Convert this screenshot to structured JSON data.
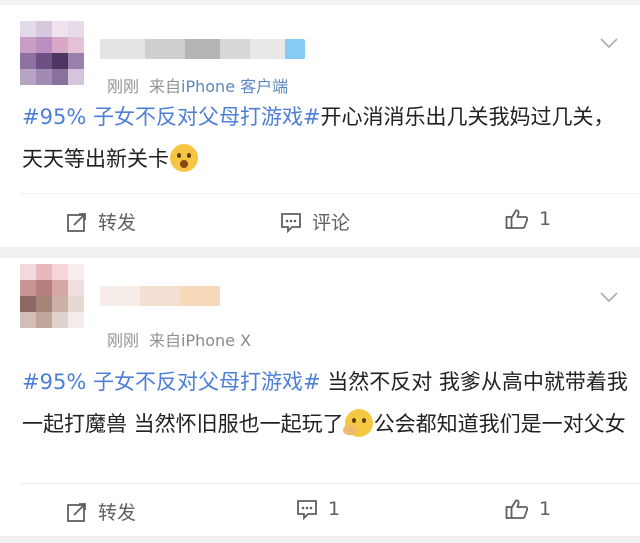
{
  "posts": [
    {
      "time": "刚刚",
      "source_prefix": "来自",
      "device": "iPhone 客户端",
      "hashtag": "#95% 子女不反对父母打游戏#",
      "text_a": "开心消消乐出几关我妈过几关，天天等出新关卡",
      "text_b": "",
      "emoji": "scream-emoji",
      "actions": {
        "repost_label": "转发",
        "comment_label": "评论",
        "like_count": "1"
      }
    },
    {
      "time": "刚刚",
      "source_prefix": "来自",
      "device": "iPhone X",
      "hashtag": "#95% 子女不反对父母打游戏#",
      "text_a": " 当然不反对 我爹从高中就带着我一起打魔兽 当然怀旧服也一起玩了",
      "text_b": "公会都知道我们是一对父女",
      "emoji": "thinking-emoji",
      "actions": {
        "repost_label": "转发",
        "comment_count": "1",
        "like_count": "1"
      }
    }
  ],
  "colors": {
    "hashtag": "#4d7fd6",
    "device_link": "#5b88bd",
    "meta": "#939393",
    "action": "#606060",
    "background": "#f1f1f1"
  },
  "icons": {
    "repost": "repost-icon",
    "comment": "comment-icon",
    "like": "thumbs-up-icon",
    "expand": "chevron-down-icon"
  }
}
